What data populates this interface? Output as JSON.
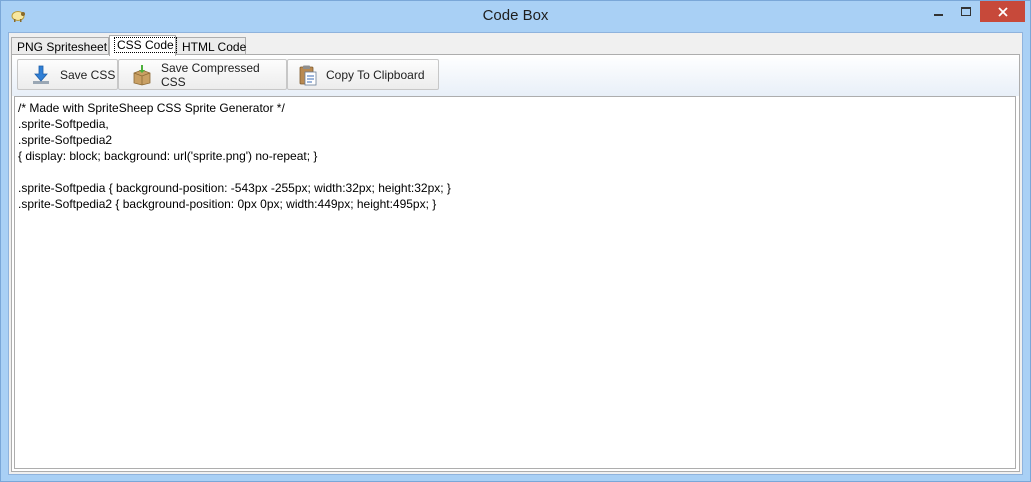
{
  "window": {
    "title": "Code Box"
  },
  "tabs": [
    {
      "label": "PNG Spritesheet"
    },
    {
      "label": "CSS Code"
    },
    {
      "label": "HTML Code"
    }
  ],
  "toolbar": {
    "save_css_label": "Save CSS",
    "save_compressed_label": "Save Compressed CSS",
    "copy_label": "Copy To Clipboard"
  },
  "editor": {
    "lines": [
      "/* Made with SpriteSheep CSS Sprite Generator */",
      ".sprite-Softpedia,",
      ".sprite-Softpedia2",
      "{ display: block; background: url('sprite.png') no-repeat; }",
      "",
      ".sprite-Softpedia { background-position: -543px -255px; width:32px; height:32px; }",
      ".sprite-Softpedia2 { background-position: 0px 0px; width:449px; height:495px; }"
    ]
  },
  "colors": {
    "titlebar": "#a9d0f5",
    "close_button": "#c7493a"
  }
}
